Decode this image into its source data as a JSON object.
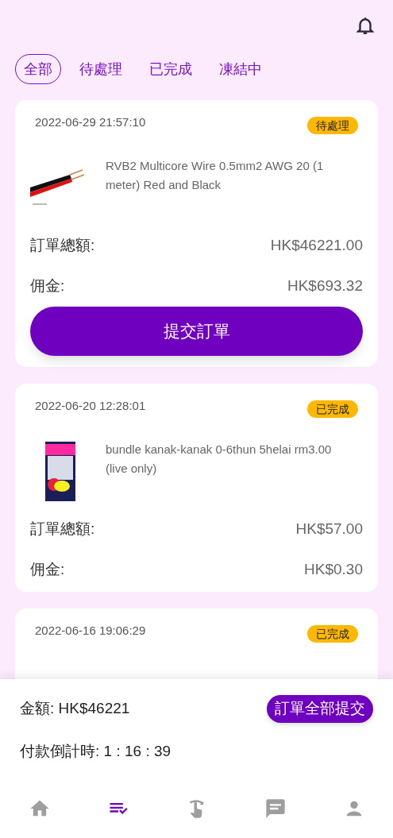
{
  "tabs": [
    {
      "label": "全部",
      "selected": true
    },
    {
      "label": "待處理",
      "selected": false
    },
    {
      "label": "已完成",
      "selected": false
    },
    {
      "label": "凍結中",
      "selected": false
    }
  ],
  "orders": [
    {
      "datetime": "2022-06-29 21:57:10",
      "status": "待處理",
      "product": {
        "title": "RVB2 Multicore Wire 0.5mm2 AWG 20 (1 meter) Red and Black"
      },
      "total_label": "訂單總額:",
      "total": "HK$46221.00",
      "commission_label": "佣金:",
      "commission": "HK$693.32",
      "submit_button": "提交訂單"
    },
    {
      "datetime": "2022-06-20 12:28:01",
      "status": "已完成",
      "product": {
        "title": "bundle kanak-kanak 0-6thun 5helai rm3.00 (live only)"
      },
      "total_label": "訂單總額:",
      "total": "HK$57.00",
      "commission_label": "佣金:",
      "commission": "HK$0.30"
    },
    {
      "datetime": "2022-06-16 19:06:29",
      "status": "已完成"
    }
  ],
  "summary": {
    "amount_label": "金額:",
    "amount": "HK$46221",
    "countdown_label": "付款倒計時:",
    "countdown": "1 : 16 : 39",
    "submit_all_button": "訂單全部提交"
  },
  "bottom_nav": [
    {
      "kind": "home",
      "selected": false
    },
    {
      "kind": "orders",
      "selected": true
    },
    {
      "kind": "tap",
      "selected": false
    },
    {
      "kind": "messages",
      "selected": false
    },
    {
      "kind": "profile",
      "selected": false
    }
  ]
}
